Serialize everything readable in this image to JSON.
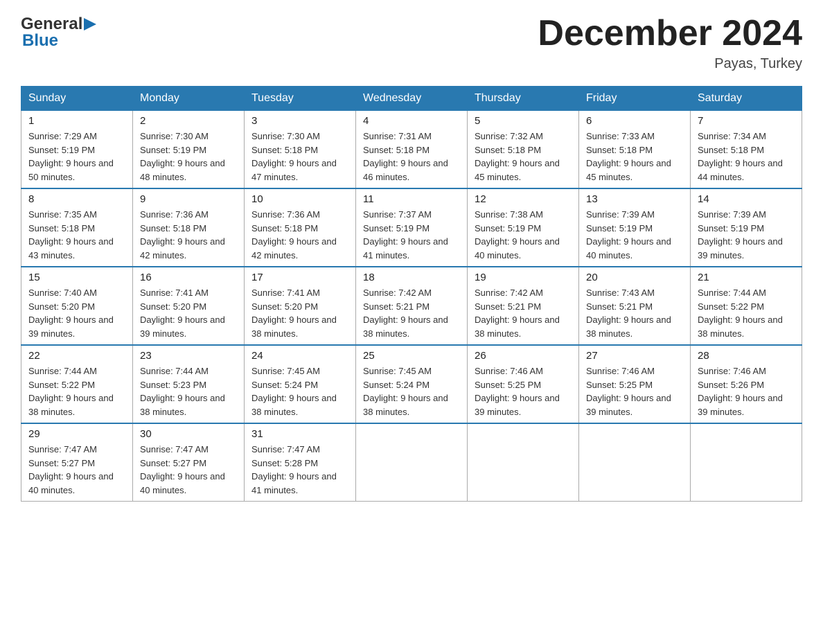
{
  "logo": {
    "general": "General",
    "triangle": "▶",
    "blue": "Blue"
  },
  "title": "December 2024",
  "location": "Payas, Turkey",
  "days_of_week": [
    "Sunday",
    "Monday",
    "Tuesday",
    "Wednesday",
    "Thursday",
    "Friday",
    "Saturday"
  ],
  "weeks": [
    [
      {
        "day": "1",
        "sunrise": "7:29 AM",
        "sunset": "5:19 PM",
        "daylight": "9 hours and 50 minutes."
      },
      {
        "day": "2",
        "sunrise": "7:30 AM",
        "sunset": "5:19 PM",
        "daylight": "9 hours and 48 minutes."
      },
      {
        "day": "3",
        "sunrise": "7:30 AM",
        "sunset": "5:18 PM",
        "daylight": "9 hours and 47 minutes."
      },
      {
        "day": "4",
        "sunrise": "7:31 AM",
        "sunset": "5:18 PM",
        "daylight": "9 hours and 46 minutes."
      },
      {
        "day": "5",
        "sunrise": "7:32 AM",
        "sunset": "5:18 PM",
        "daylight": "9 hours and 45 minutes."
      },
      {
        "day": "6",
        "sunrise": "7:33 AM",
        "sunset": "5:18 PM",
        "daylight": "9 hours and 45 minutes."
      },
      {
        "day": "7",
        "sunrise": "7:34 AM",
        "sunset": "5:18 PM",
        "daylight": "9 hours and 44 minutes."
      }
    ],
    [
      {
        "day": "8",
        "sunrise": "7:35 AM",
        "sunset": "5:18 PM",
        "daylight": "9 hours and 43 minutes."
      },
      {
        "day": "9",
        "sunrise": "7:36 AM",
        "sunset": "5:18 PM",
        "daylight": "9 hours and 42 minutes."
      },
      {
        "day": "10",
        "sunrise": "7:36 AM",
        "sunset": "5:18 PM",
        "daylight": "9 hours and 42 minutes."
      },
      {
        "day": "11",
        "sunrise": "7:37 AM",
        "sunset": "5:19 PM",
        "daylight": "9 hours and 41 minutes."
      },
      {
        "day": "12",
        "sunrise": "7:38 AM",
        "sunset": "5:19 PM",
        "daylight": "9 hours and 40 minutes."
      },
      {
        "day": "13",
        "sunrise": "7:39 AM",
        "sunset": "5:19 PM",
        "daylight": "9 hours and 40 minutes."
      },
      {
        "day": "14",
        "sunrise": "7:39 AM",
        "sunset": "5:19 PM",
        "daylight": "9 hours and 39 minutes."
      }
    ],
    [
      {
        "day": "15",
        "sunrise": "7:40 AM",
        "sunset": "5:20 PM",
        "daylight": "9 hours and 39 minutes."
      },
      {
        "day": "16",
        "sunrise": "7:41 AM",
        "sunset": "5:20 PM",
        "daylight": "9 hours and 39 minutes."
      },
      {
        "day": "17",
        "sunrise": "7:41 AM",
        "sunset": "5:20 PM",
        "daylight": "9 hours and 38 minutes."
      },
      {
        "day": "18",
        "sunrise": "7:42 AM",
        "sunset": "5:21 PM",
        "daylight": "9 hours and 38 minutes."
      },
      {
        "day": "19",
        "sunrise": "7:42 AM",
        "sunset": "5:21 PM",
        "daylight": "9 hours and 38 minutes."
      },
      {
        "day": "20",
        "sunrise": "7:43 AM",
        "sunset": "5:21 PM",
        "daylight": "9 hours and 38 minutes."
      },
      {
        "day": "21",
        "sunrise": "7:44 AM",
        "sunset": "5:22 PM",
        "daylight": "9 hours and 38 minutes."
      }
    ],
    [
      {
        "day": "22",
        "sunrise": "7:44 AM",
        "sunset": "5:22 PM",
        "daylight": "9 hours and 38 minutes."
      },
      {
        "day": "23",
        "sunrise": "7:44 AM",
        "sunset": "5:23 PM",
        "daylight": "9 hours and 38 minutes."
      },
      {
        "day": "24",
        "sunrise": "7:45 AM",
        "sunset": "5:24 PM",
        "daylight": "9 hours and 38 minutes."
      },
      {
        "day": "25",
        "sunrise": "7:45 AM",
        "sunset": "5:24 PM",
        "daylight": "9 hours and 38 minutes."
      },
      {
        "day": "26",
        "sunrise": "7:46 AM",
        "sunset": "5:25 PM",
        "daylight": "9 hours and 39 minutes."
      },
      {
        "day": "27",
        "sunrise": "7:46 AM",
        "sunset": "5:25 PM",
        "daylight": "9 hours and 39 minutes."
      },
      {
        "day": "28",
        "sunrise": "7:46 AM",
        "sunset": "5:26 PM",
        "daylight": "9 hours and 39 minutes."
      }
    ],
    [
      {
        "day": "29",
        "sunrise": "7:47 AM",
        "sunset": "5:27 PM",
        "daylight": "9 hours and 40 minutes."
      },
      {
        "day": "30",
        "sunrise": "7:47 AM",
        "sunset": "5:27 PM",
        "daylight": "9 hours and 40 minutes."
      },
      {
        "day": "31",
        "sunrise": "7:47 AM",
        "sunset": "5:28 PM",
        "daylight": "9 hours and 41 minutes."
      },
      null,
      null,
      null,
      null
    ]
  ]
}
